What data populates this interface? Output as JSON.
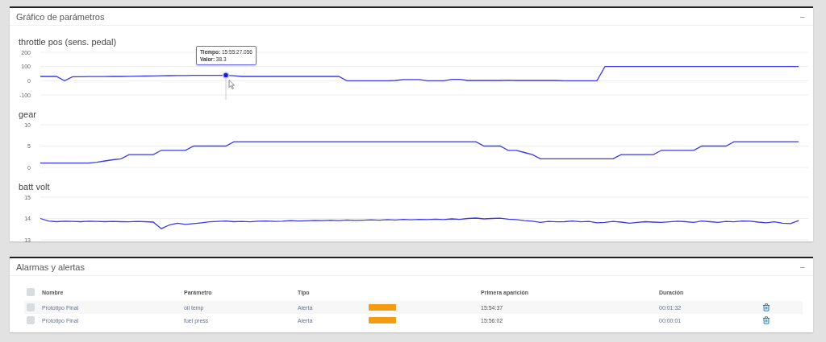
{
  "chart_panel": {
    "title": "Gráfico de parámetros",
    "collapse": "−",
    "charts": [
      {
        "chart_data": {
          "type": "line",
          "ylim": [
            -100,
            200
          ],
          "yticks": [
            200,
            100,
            0,
            -100
          ],
          "categories": [
            null,
            null,
            null,
            null,
            null,
            null,
            null,
            null,
            null,
            null,
            null,
            null,
            null,
            null,
            null,
            null,
            null,
            null,
            null,
            null,
            null,
            null,
            null,
            null,
            null,
            null,
            null,
            null,
            null,
            null,
            null,
            null,
            null,
            null,
            null,
            null,
            null,
            null,
            null,
            null,
            null,
            null,
            null,
            null,
            null,
            null,
            null,
            null,
            null,
            null,
            null,
            null,
            null,
            null,
            null,
            null,
            null,
            null,
            null,
            null,
            null,
            null,
            null,
            null,
            null,
            null,
            null,
            null,
            null,
            null,
            null,
            null,
            null,
            null,
            null,
            null,
            null,
            null,
            null,
            null,
            null,
            null,
            null,
            null,
            null,
            null,
            null,
            null,
            null,
            null,
            null,
            null,
            null,
            null,
            null
          ],
          "series": [
            {
              "name": "throttle pos (sens. pedal)",
              "color": "#3a3ae8",
              "values": [
                30,
                30,
                30,
                0,
                28,
                28,
                29,
                29,
                29,
                30,
                30,
                31,
                32,
                33,
                34,
                35,
                36,
                37,
                37,
                38,
                38,
                38,
                38,
                38,
                35,
                30,
                30,
                30,
                30,
                30,
                30,
                30,
                30,
                30,
                30,
                30,
                30,
                30,
                0,
                0,
                0,
                0,
                0,
                0,
                2,
                8,
                8,
                8,
                0,
                0,
                0,
                10,
                10,
                2,
                2,
                2,
                2,
                2,
                4,
                2,
                2,
                2,
                2,
                2,
                2,
                0,
                0,
                0,
                0,
                0,
                100,
                100,
                100,
                100,
                100,
                100,
                100,
                100,
                100,
                100,
                100,
                100,
                100,
                100,
                100,
                100,
                100,
                100,
                100,
                100,
                100,
                100,
                100,
                100,
                100
              ]
            }
          ]
        },
        "tooltip": [
          "**Tiempo:** 15:55:27.056",
          "**Valor:** 38.3"
        ]
      },
      {
        "chart_data": {
          "type": "line",
          "ylim": [
            0,
            10
          ],
          "yticks": [
            10,
            5,
            0
          ],
          "categories": [
            null,
            null,
            null,
            null,
            null,
            null,
            null,
            null,
            null,
            null,
            null,
            null,
            null,
            null,
            null,
            null,
            null,
            null,
            null,
            null,
            null,
            null,
            null,
            null,
            null,
            null,
            null,
            null,
            null,
            null,
            null,
            null,
            null,
            null,
            null,
            null,
            null,
            null,
            null,
            null,
            null,
            null,
            null,
            null,
            null,
            null,
            null,
            null,
            null,
            null,
            null,
            null,
            null,
            null,
            null,
            null,
            null,
            null,
            null,
            null,
            null,
            null,
            null,
            null,
            null,
            null,
            null,
            null,
            null,
            null,
            null,
            null,
            null,
            null,
            null,
            null,
            null,
            null,
            null,
            null,
            null,
            null,
            null,
            null,
            null,
            null,
            null,
            null,
            null,
            null,
            null,
            null,
            null,
            null,
            null
          ],
          "series": [
            {
              "name": "gear",
              "color": "#3a3ae8",
              "values": [
                1,
                1,
                1,
                1,
                1,
                1,
                1,
                1.2,
                1.5,
                1.8,
                2,
                3,
                3,
                3,
                3,
                4,
                4,
                4,
                4,
                5,
                5,
                5,
                5,
                5,
                6,
                6,
                6,
                6,
                6,
                6,
                6,
                6,
                6,
                6,
                6,
                6,
                6,
                6,
                6,
                6,
                6,
                6,
                6,
                6,
                6,
                6,
                6,
                6,
                6,
                6,
                6,
                6,
                6,
                6,
                6,
                5,
                5,
                5,
                4,
                4,
                3.5,
                3,
                2,
                2,
                2,
                2,
                2,
                2,
                2,
                2,
                2,
                2,
                3,
                3,
                3,
                3,
                3,
                4,
                4,
                4,
                4,
                4,
                5,
                5,
                5,
                5,
                6,
                6,
                6,
                6,
                6,
                6,
                6,
                6,
                6
              ]
            }
          ]
        }
      },
      {
        "chart_data": {
          "type": "line",
          "ylim": [
            13,
            15
          ],
          "yticks": [
            15,
            14,
            13
          ],
          "categories": [
            null,
            null,
            null,
            null,
            null,
            null,
            null,
            null,
            null,
            null,
            null,
            null,
            null,
            null,
            null,
            null,
            null,
            null,
            null,
            null,
            null,
            null,
            null,
            null,
            null,
            null,
            null,
            null,
            null,
            null,
            null,
            null,
            null,
            null,
            null,
            null,
            null,
            null,
            null,
            null,
            null,
            null,
            null,
            null,
            null,
            null,
            null,
            null,
            null,
            null,
            null,
            null,
            null,
            null,
            null,
            null,
            null,
            null,
            null,
            null,
            null,
            null,
            null,
            null,
            null,
            null,
            null,
            null,
            null,
            null,
            null,
            null,
            null,
            null,
            null,
            null,
            null,
            null,
            null,
            null,
            null,
            null,
            null,
            null,
            null,
            null,
            null,
            null,
            null,
            null,
            null,
            null,
            null,
            null,
            null
          ],
          "series": [
            {
              "name": "batt volt",
              "color": "#3a3ae8",
              "values": [
                14,
                13.88,
                13.85,
                13.87,
                13.86,
                13.85,
                13.87,
                13.86,
                13.85,
                13.86,
                13.85,
                13.84,
                13.86,
                13.85,
                13.83,
                13.52,
                13.7,
                13.78,
                13.72,
                13.76,
                13.8,
                13.84,
                13.86,
                13.88,
                13.85,
                13.86,
                13.84,
                13.87,
                13.88,
                13.86,
                13.87,
                13.9,
                13.88,
                13.89,
                13.91,
                13.9,
                13.92,
                13.9,
                13.93,
                13.91,
                13.92,
                13.94,
                13.92,
                13.95,
                13.93,
                13.96,
                13.94,
                13.96,
                13.95,
                13.97,
                13.95,
                13.98,
                13.96,
                14,
                14.02,
                13.98,
                14,
                14.01,
                13.97,
                13.95,
                13.9,
                13.87,
                13.82,
                13.86,
                13.84,
                13.85,
                13.88,
                13.84,
                13.86,
                13.8,
                13.82,
                13.86,
                13.83,
                13.78,
                13.82,
                13.85,
                13.83,
                13.82,
                13.84,
                13.87,
                13.85,
                13.82,
                13.88,
                13.85,
                13.82,
                13.86,
                13.84,
                13.88,
                13.87,
                13.83,
                13.8,
                13.84,
                13.78,
                13.76,
                13.9
              ]
            }
          ]
        }
      }
    ]
  },
  "alarm_panel": {
    "title": "Alarmas y alertas",
    "collapse": "−",
    "header": {
      "checked": false,
      "columns": [
        "Nombre",
        "Parámetro",
        "Tipo",
        "Primera aparición",
        "Duración"
      ]
    },
    "rows": [
      {
        "checked": false,
        "name": "Prototipo Final",
        "parameter": "oil temp",
        "type": "Alerta",
        "color": "#f39c12",
        "first_seen": "15:54:37",
        "duration": "00:01:32"
      },
      {
        "checked": false,
        "name": "Prototipo Final",
        "parameter": "fuel press",
        "type": "Alerta",
        "color": "#f39c12",
        "first_seen": "15:56:02",
        "duration": "00:00:01"
      }
    ]
  }
}
